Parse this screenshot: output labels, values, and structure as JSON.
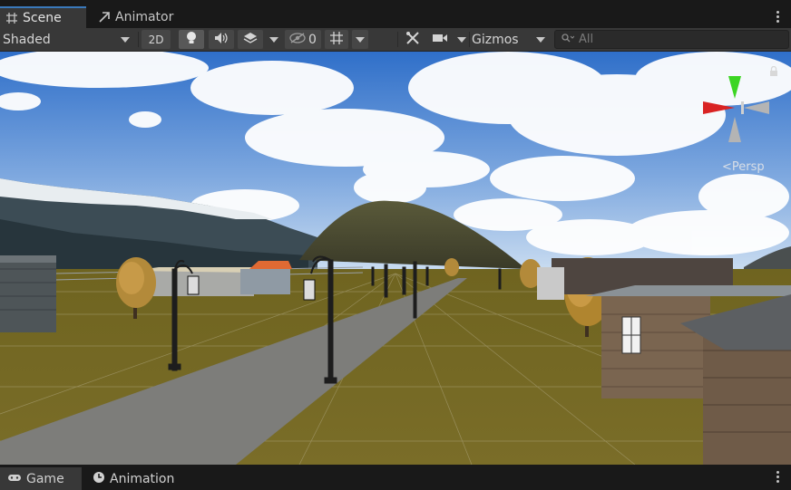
{
  "tabs": {
    "scene": {
      "label": "Scene",
      "icon": "grid-icon"
    },
    "animator": {
      "label": "Animator",
      "icon": "animator-icon"
    }
  },
  "toolbar": {
    "shading_mode": "Shaded",
    "mode_2d": "2D",
    "hidden_count": "0",
    "gizmos": "Gizmos",
    "search_placeholder": "All"
  },
  "gizmo": {
    "projection": "<Persp"
  },
  "bottom_tabs": {
    "game": {
      "label": "Game",
      "icon": "gamepad-icon"
    },
    "animation": {
      "label": "Animation",
      "icon": "clock-icon"
    }
  },
  "colors": {
    "accent": "#3a79bb",
    "panel": "#383838",
    "background": "#191919",
    "x_axis": "#d92323",
    "y_axis": "#3cd523"
  }
}
